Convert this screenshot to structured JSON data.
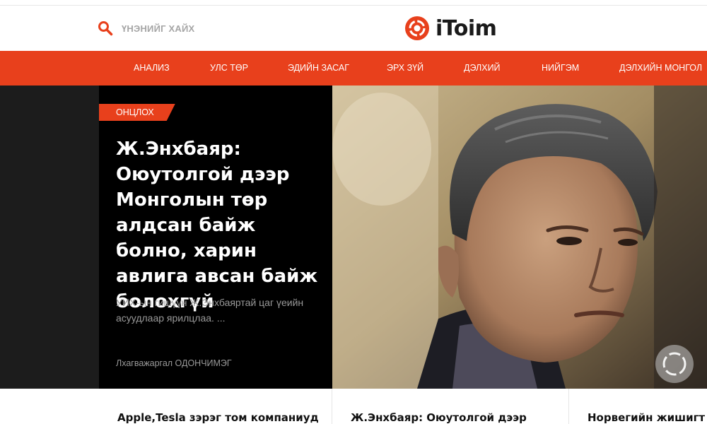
{
  "header": {
    "search_placeholder": "ҮНЭНИЙГ ХАЙХ",
    "logo_text": "iToim",
    "accent_color": "#e8401c"
  },
  "nav": {
    "items": [
      {
        "label": "АНАЛИЗ"
      },
      {
        "label": "УЛС ТӨР"
      },
      {
        "label": "ЭДИЙН ЗАСАГ"
      },
      {
        "label": "ЭРХ ЗҮЙ"
      },
      {
        "label": "ДЭЛХИЙ"
      },
      {
        "label": "НИЙГЭМ"
      },
      {
        "label": "ДЭЛХИЙН МОНГОЛ"
      }
    ]
  },
  "hero": {
    "tag": "ОНЦЛОХ",
    "title": "Ж.Энхбаяр: Оюутолгой дээр Монголын төр алдсан байж болно, харин авлига авсан байж болохгүй",
    "description": "УИХ-ын гишүүн Ж.Энхбаяртай цаг үеийн асуудлаар ярилцлаа. ...",
    "author": "Лхагважаргал ОДОНЧИМЭГ"
  },
  "cards": [
    {
      "title": "Apple,Tesla зэрэг том компаниуд"
    },
    {
      "title": "Ж.Энхбаяр: Оюутолгой дээр"
    },
    {
      "title": "Норвегийн жишигт ту"
    }
  ]
}
